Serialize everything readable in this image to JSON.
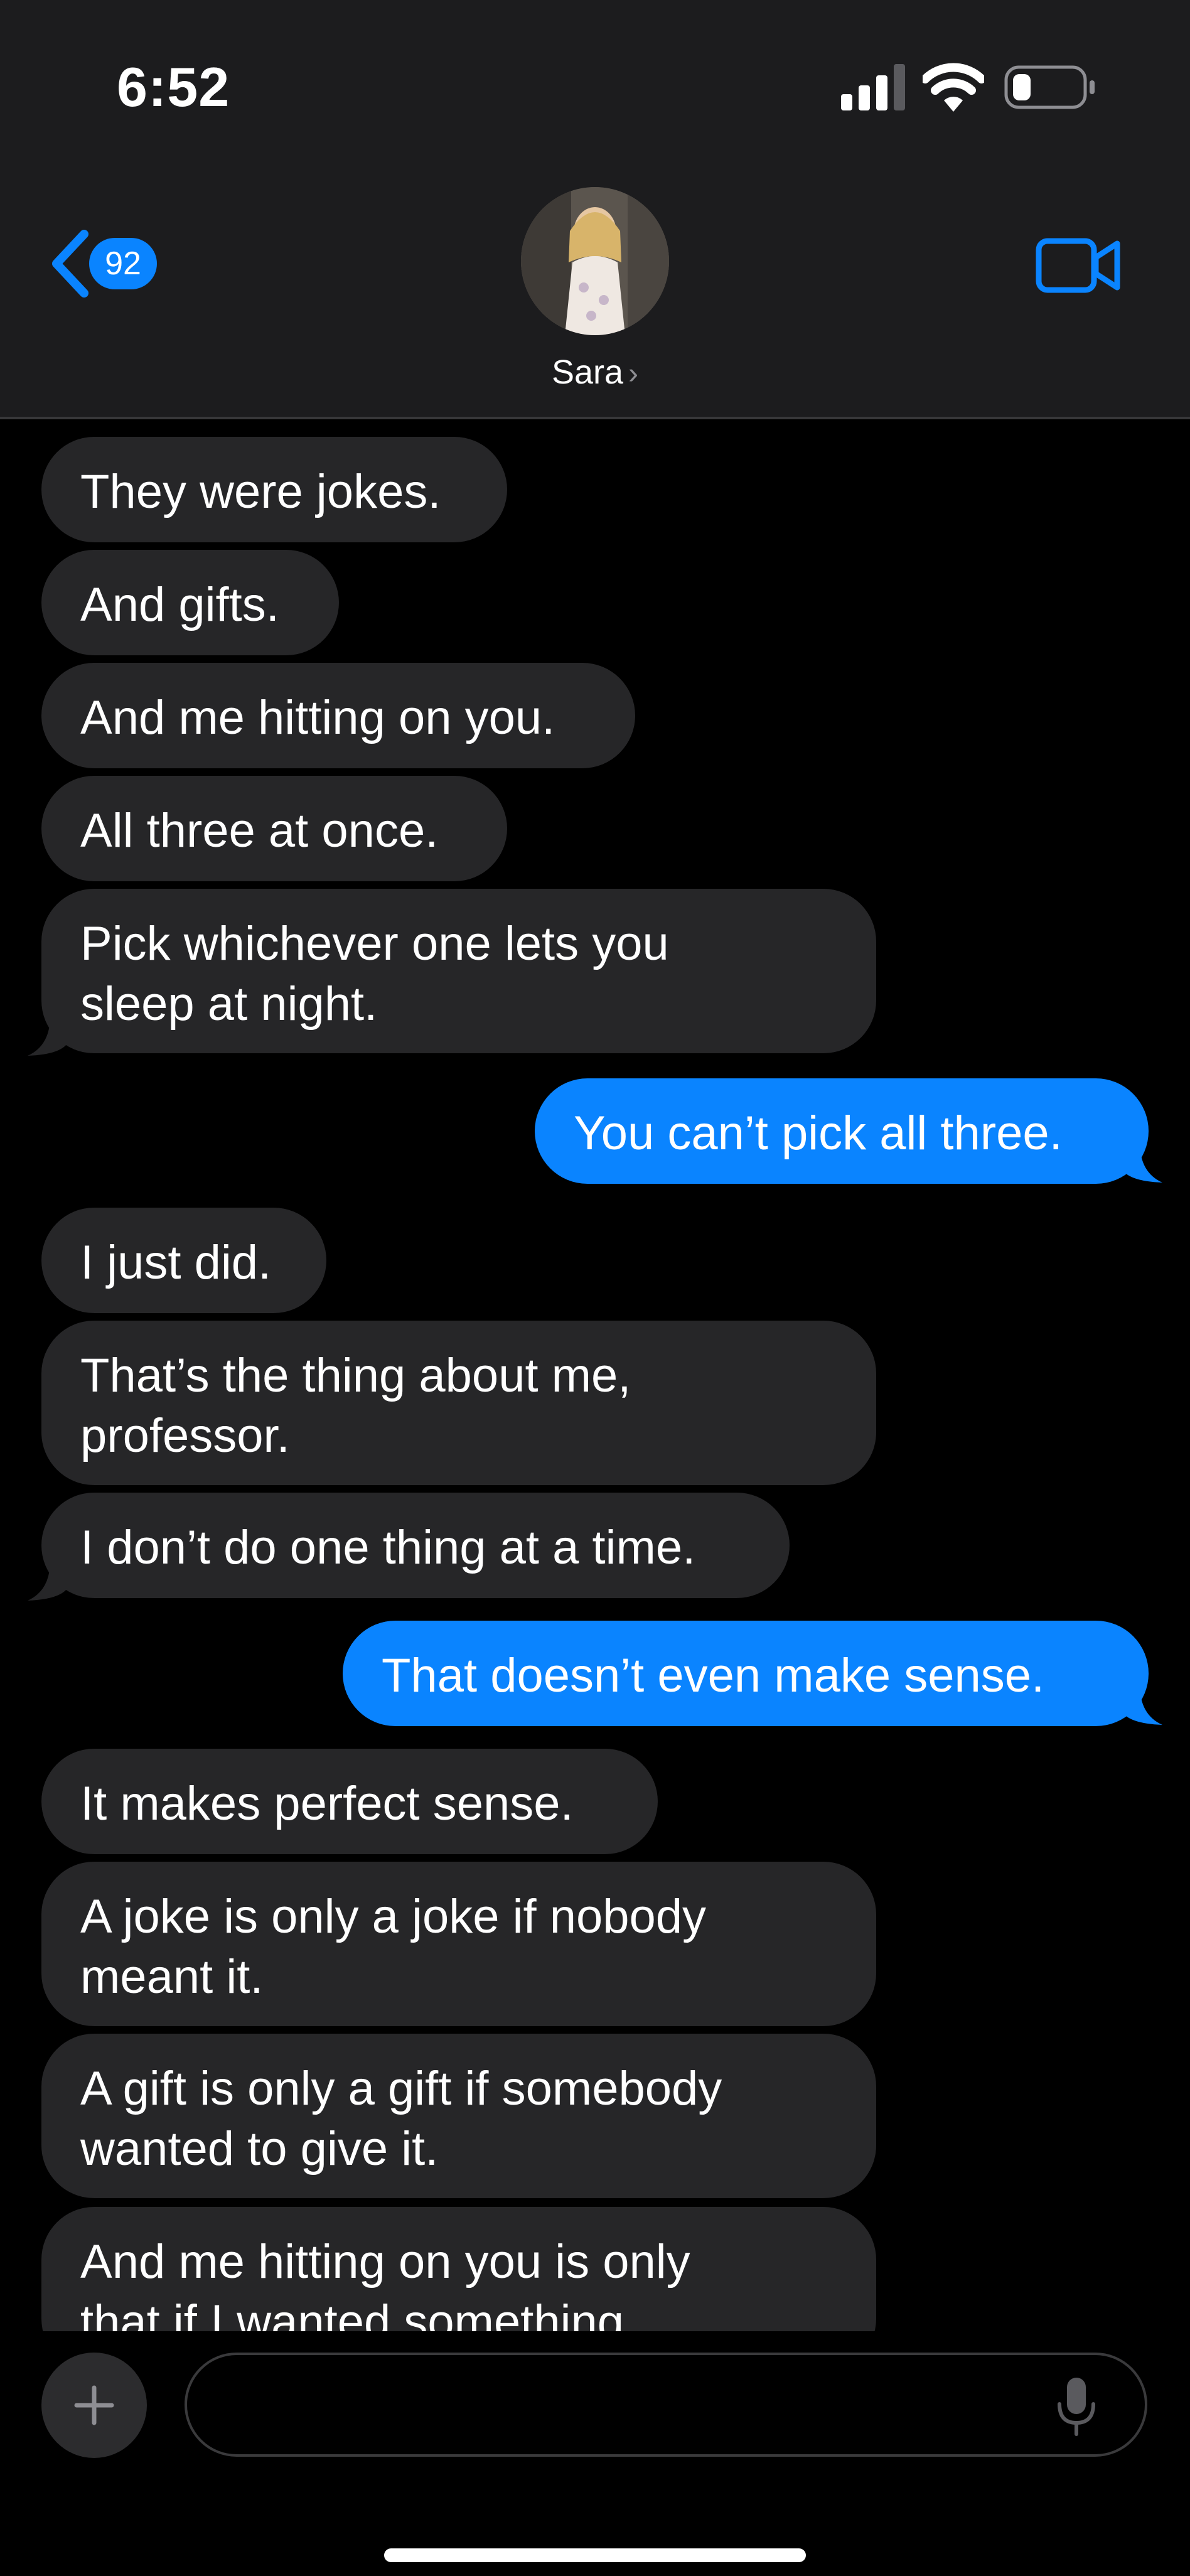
{
  "status_bar": {
    "time": "6:52"
  },
  "header": {
    "back_badge": "92",
    "contact_name": "Sara",
    "contact_chevron": "›"
  },
  "messages": [
    {
      "sender": "them",
      "text": "They were jokes."
    },
    {
      "sender": "them",
      "text": "And gifts."
    },
    {
      "sender": "them",
      "text": "And me hitting on you."
    },
    {
      "sender": "them",
      "text": "All three at once."
    },
    {
      "sender": "them",
      "text": "Pick whichever one lets you\nsleep at night."
    },
    {
      "sender": "me",
      "text": "You can’t pick all three."
    },
    {
      "sender": "them",
      "text": "I just did."
    },
    {
      "sender": "them",
      "text": "That’s the thing about me,\nprofessor."
    },
    {
      "sender": "them",
      "text": "I don’t do one thing at a time."
    },
    {
      "sender": "me",
      "text": "That doesn’t even make sense."
    },
    {
      "sender": "them",
      "text": "It makes perfect sense."
    },
    {
      "sender": "them",
      "text": "A joke is only a joke if nobody\nmeant it."
    },
    {
      "sender": "them",
      "text": "A gift is only a gift if somebody\nwanted to give it."
    },
    {
      "sender": "them",
      "text": "And me hitting on you is only\nthat if I wanted something."
    }
  ],
  "composer": {
    "placeholder": ""
  },
  "colors": {
    "incoming_bubble": "#262628",
    "outgoing_bubble": "#0a84ff",
    "header_bg": "#1c1c1e",
    "accent": "#0a84ff"
  },
  "icons": [
    "signal-icon",
    "wifi-icon",
    "battery-icon",
    "back-chevron-icon",
    "video-camera-icon",
    "plus-icon",
    "microphone-icon"
  ]
}
